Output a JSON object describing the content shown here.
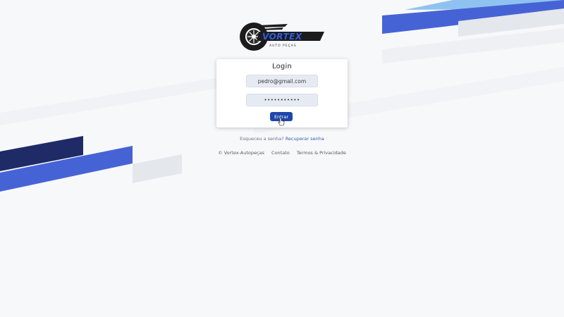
{
  "logo": {
    "brand": "VORTEX",
    "tagline": "AUTO PEÇAS"
  },
  "login": {
    "title": "Login",
    "email_value": "pedro@gmail.com",
    "password_value": "•••••••••••",
    "submit_label": "Entrar"
  },
  "forgot": {
    "question": "Esqueceu a senha?",
    "link": "Recuperar senha"
  },
  "footer": {
    "copyright": "© Vortex-Autopeças",
    "contact": "Contato",
    "terms": "Termos & Privacidade"
  },
  "colors": {
    "accent": "#1f46a8",
    "stripe_dark": "#1f2b66",
    "stripe_blue": "#3d63d6",
    "stripe_light": "#7fb6ec"
  }
}
